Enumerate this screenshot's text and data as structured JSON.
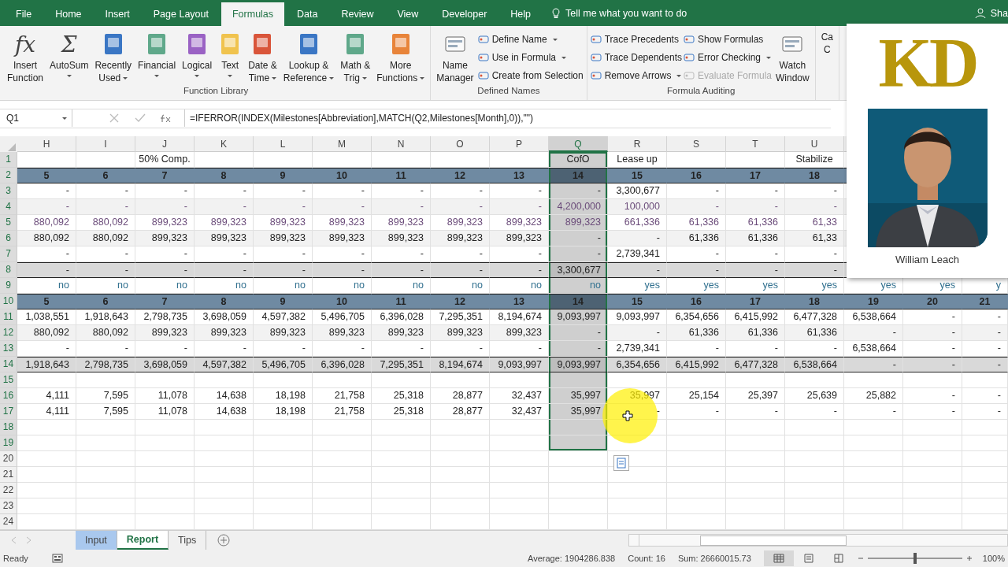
{
  "ribbon": {
    "tabs": [
      {
        "label": "File",
        "selected": false
      },
      {
        "label": "Home",
        "selected": false
      },
      {
        "label": "Insert",
        "selected": false
      },
      {
        "label": "Page Layout",
        "selected": false
      },
      {
        "label": "Formulas",
        "selected": true
      },
      {
        "label": "Data",
        "selected": false
      },
      {
        "label": "Review",
        "selected": false
      },
      {
        "label": "View",
        "selected": false
      },
      {
        "label": "Developer",
        "selected": false
      },
      {
        "label": "Help",
        "selected": false
      }
    ],
    "tell_me": "Tell me what you want to do",
    "share": "Sha",
    "groups": [
      {
        "title": "Function Library",
        "columns": [
          {
            "kind": "large",
            "glyph": "fx",
            "lines": [
              "Insert",
              "Function"
            ],
            "dropdown": false
          },
          {
            "kind": "large",
            "glyph": "Σ",
            "lines": [
              "AutoSum"
            ],
            "dropdown": true
          },
          {
            "kind": "large",
            "color": "#3a76c4",
            "lines": [
              "Recently",
              "Used"
            ],
            "dropdown": true
          },
          {
            "kind": "large",
            "color": "#5fa88a",
            "lines": [
              "Financial"
            ],
            "dropdown": true
          },
          {
            "kind": "large",
            "color": "#9a62c4",
            "lines": [
              "Logical"
            ],
            "dropdown": true
          },
          {
            "kind": "large",
            "color": "#f0c34e",
            "lines": [
              "Text"
            ],
            "dropdown": true
          },
          {
            "kind": "large",
            "color": "#d9553a",
            "lines": [
              "Date &",
              "Time"
            ],
            "dropdown": true
          },
          {
            "kind": "large",
            "color": "#3a76c4",
            "lines": [
              "Lookup &",
              "Reference"
            ],
            "dropdown": true
          },
          {
            "kind": "large",
            "color": "#5fa88a",
            "lines": [
              "Math &",
              "Trig"
            ],
            "dropdown": true
          },
          {
            "kind": "large",
            "color": "#e8843a",
            "lines": [
              "More",
              "Functions"
            ],
            "dropdown": true
          }
        ]
      },
      {
        "title": "Defined Names",
        "columns": [
          {
            "kind": "large",
            "lines": [
              "Name",
              "Manager"
            ],
            "dropdown": false
          },
          {
            "kind": "stack",
            "items": [
              {
                "label": "Define Name",
                "dropdown": true,
                "disabled": false
              },
              {
                "label": "Use in Formula",
                "dropdown": true,
                "disabled": false
              },
              {
                "label": "Create from Selection",
                "dropdown": false,
                "disabled": false
              }
            ]
          }
        ]
      },
      {
        "title": "Formula Auditing",
        "columns": [
          {
            "kind": "stack",
            "items": [
              {
                "label": "Trace Precedents",
                "dropdown": false,
                "disabled": false
              },
              {
                "label": "Trace Dependents",
                "dropdown": false,
                "disabled": false
              },
              {
                "label": "Remove Arrows",
                "dropdown": true,
                "disabled": false
              }
            ]
          },
          {
            "kind": "stack",
            "items": [
              {
                "label": "Show Formulas",
                "dropdown": false,
                "disabled": false
              },
              {
                "label": "Error Checking",
                "dropdown": true,
                "disabled": false
              },
              {
                "label": "Evaluate Formula",
                "dropdown": false,
                "disabled": true
              }
            ]
          },
          {
            "kind": "large",
            "lines": [
              "Watch",
              "Window"
            ],
            "dropdown": false
          }
        ]
      },
      {
        "columns": [
          {
            "kind": "cut",
            "lines": [
              "Ca",
              "C"
            ]
          }
        ]
      }
    ]
  },
  "formula_bar": {
    "name_box": "Q1",
    "formula": "=IFERROR(INDEX(Milestones[Abbreviation],MATCH(Q2,Milestones[Month],0)),\"\")"
  },
  "columns": [
    {
      "letter": "H",
      "selected": false
    },
    {
      "letter": "I",
      "selected": false
    },
    {
      "letter": "J",
      "selected": false
    },
    {
      "letter": "K",
      "selected": false
    },
    {
      "letter": "L",
      "selected": false
    },
    {
      "letter": "M",
      "selected": false
    },
    {
      "letter": "N",
      "selected": false
    },
    {
      "letter": "O",
      "selected": false
    },
    {
      "letter": "P",
      "selected": false
    },
    {
      "letter": "Q",
      "selected": true
    },
    {
      "letter": "R",
      "selected": false
    },
    {
      "letter": "S",
      "selected": false
    },
    {
      "letter": "T",
      "selected": false
    },
    {
      "letter": "U",
      "selected": false
    }
  ],
  "rows": [
    {
      "num": "1",
      "kind": "title",
      "banded": false,
      "selected": true,
      "cells": [
        null,
        null,
        "50% Comp.",
        null,
        null,
        null,
        null,
        null,
        null,
        "CofO",
        "Lease up",
        null,
        null,
        "Stabilize"
      ]
    },
    {
      "num": "2",
      "kind": "header",
      "banded": false,
      "selected": true,
      "cells": [
        "5",
        "6",
        "7",
        "8",
        "9",
        "10",
        "11",
        "12",
        "13",
        "14",
        "15",
        "16",
        "17",
        "18"
      ]
    },
    {
      "num": "3",
      "kind": "data",
      "banded": false,
      "selected": true,
      "cells": [
        "-",
        "-",
        "-",
        "-",
        "-",
        "-",
        "-",
        "-",
        "-",
        "-",
        "3,300,677",
        "-",
        "-",
        "-"
      ]
    },
    {
      "num": "4",
      "kind": "input",
      "banded": true,
      "selected": true,
      "cells": [
        "-",
        "-",
        "-",
        "-",
        "-",
        "-",
        "-",
        "-",
        "-",
        "4,200,000",
        "100,000",
        "-",
        "-",
        "-"
      ]
    },
    {
      "num": "5",
      "kind": "input",
      "banded": false,
      "selected": true,
      "cells": [
        "880,092",
        "880,092",
        "899,323",
        "899,323",
        "899,323",
        "899,323",
        "899,323",
        "899,323",
        "899,323",
        "899,323",
        "661,336",
        "61,336",
        "61,336",
        "61,33"
      ]
    },
    {
      "num": "6",
      "kind": "data",
      "banded": true,
      "selected": true,
      "cells": [
        "880,092",
        "880,092",
        "899,323",
        "899,323",
        "899,323",
        "899,323",
        "899,323",
        "899,323",
        "899,323",
        "-",
        "-",
        "61,336",
        "61,336",
        "61,33"
      ]
    },
    {
      "num": "7",
      "kind": "data",
      "banded": false,
      "selected": true,
      "cells": [
        "-",
        "-",
        "-",
        "-",
        "-",
        "-",
        "-",
        "-",
        "-",
        "-",
        "2,739,341",
        "-",
        "-",
        "-"
      ]
    },
    {
      "num": "8",
      "kind": "total",
      "banded": false,
      "selected": true,
      "cells": [
        "-",
        "-",
        "-",
        "-",
        "-",
        "-",
        "-",
        "-",
        "-",
        "3,300,677",
        "-",
        "-",
        "-",
        "-"
      ]
    },
    {
      "num": "9",
      "kind": "flag",
      "banded": false,
      "selected": true,
      "cells": [
        "no",
        "no",
        "no",
        "no",
        "no",
        "no",
        "no",
        "no",
        "no",
        "no",
        "yes",
        "yes",
        "yes",
        "yes",
        "yes",
        "yes",
        "y"
      ]
    },
    {
      "num": "10",
      "kind": "header",
      "banded": false,
      "selected": true,
      "cells": [
        "5",
        "6",
        "7",
        "8",
        "9",
        "10",
        "11",
        "12",
        "13",
        "14",
        "15",
        "16",
        "17",
        "18",
        "19",
        "20",
        "21"
      ]
    },
    {
      "num": "11",
      "kind": "data",
      "banded": false,
      "selected": true,
      "cells": [
        "1,038,551",
        "1,918,643",
        "2,798,735",
        "3,698,059",
        "4,597,382",
        "5,496,705",
        "6,396,028",
        "7,295,351",
        "8,194,674",
        "9,093,997",
        "9,093,997",
        "6,354,656",
        "6,415,992",
        "6,477,328",
        "6,538,664",
        "-",
        "-"
      ]
    },
    {
      "num": "12",
      "kind": "data",
      "banded": true,
      "selected": true,
      "cells": [
        "880,092",
        "880,092",
        "899,323",
        "899,323",
        "899,323",
        "899,323",
        "899,323",
        "899,323",
        "899,323",
        "-",
        "-",
        "61,336",
        "61,336",
        "61,336",
        "-",
        "-",
        "-"
      ]
    },
    {
      "num": "13",
      "kind": "data",
      "banded": false,
      "selected": true,
      "cells": [
        "-",
        "-",
        "-",
        "-",
        "-",
        "-",
        "-",
        "-",
        "-",
        "-",
        "2,739,341",
        "-",
        "-",
        "-",
        "6,538,664",
        "-",
        "-"
      ]
    },
    {
      "num": "14",
      "kind": "total",
      "banded": false,
      "selected": true,
      "cells": [
        "1,918,643",
        "2,798,735",
        "3,698,059",
        "4,597,382",
        "5,496,705",
        "6,396,028",
        "7,295,351",
        "8,194,674",
        "9,093,997",
        "9,093,997",
        "6,354,656",
        "6,415,992",
        "6,477,328",
        "6,538,664",
        "-",
        "-",
        "-"
      ]
    },
    {
      "num": "15",
      "kind": "blank",
      "banded": false,
      "selected": true
    },
    {
      "num": "16",
      "kind": "data",
      "banded": false,
      "selected": true,
      "cells": [
        "4,111",
        "7,595",
        "11,078",
        "14,638",
        "18,198",
        "21,758",
        "25,318",
        "28,877",
        "32,437",
        "35,997",
        "35,997",
        "25,154",
        "25,397",
        "25,639",
        "25,882",
        "-",
        "-"
      ]
    },
    {
      "num": "17",
      "kind": "data",
      "banded": false,
      "selected": true,
      "cells": [
        "4,111",
        "7,595",
        "11,078",
        "14,638",
        "18,198",
        "21,758",
        "25,318",
        "28,877",
        "32,437",
        "35,997",
        "-",
        "-",
        "-",
        "-",
        "-",
        "-",
        "-"
      ]
    },
    {
      "num": "18",
      "kind": "blank",
      "banded": false,
      "selected": true
    },
    {
      "num": "19",
      "kind": "blank",
      "banded": false,
      "selected": true
    },
    {
      "num": "20",
      "kind": "blank",
      "banded": false,
      "selected": false
    },
    {
      "num": "21",
      "kind": "blank",
      "banded": false,
      "selected": false
    },
    {
      "num": "22",
      "kind": "blank",
      "banded": false,
      "selected": false
    },
    {
      "num": "23",
      "kind": "blank",
      "banded": false,
      "selected": false
    },
    {
      "num": "24",
      "kind": "blank",
      "banded": false,
      "selected": false
    }
  ],
  "presenter": {
    "logo": "KD",
    "name": "William Leach"
  },
  "sheet_tabs": [
    {
      "label": "Input",
      "selected": false,
      "highlighted": true
    },
    {
      "label": "Report",
      "selected": true,
      "highlighted": false
    },
    {
      "label": "Tips",
      "selected": false,
      "highlighted": false
    }
  ],
  "status_bar": {
    "mode": "Ready",
    "average": "Average: 1904286.838",
    "count": "Count: 16",
    "sum": "Sum: 26660015.73",
    "zoom": "100%",
    "zoom_level": {
      "level": 0.5
    }
  }
}
